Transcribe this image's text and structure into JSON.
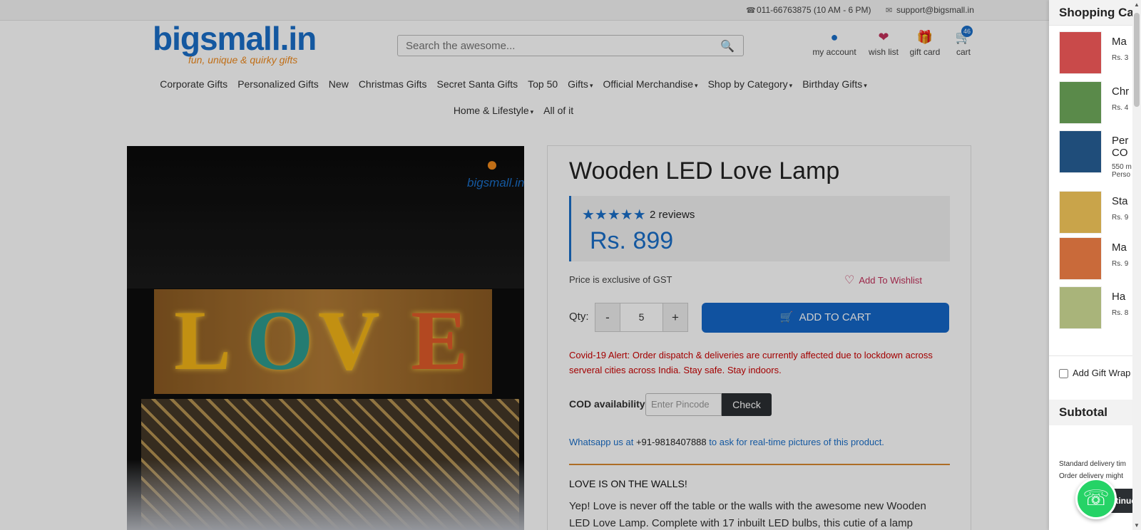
{
  "topbar": {
    "phone": "011-66763875 (10 AM - 6 PM)",
    "email": "support@bigsmall.in"
  },
  "logo": {
    "name": "bigsmall.in",
    "tagline": "fun, unique & quirky gifts"
  },
  "search": {
    "placeholder": "Search the awesome..."
  },
  "header_icons": {
    "account": "my account",
    "wishlist": "wish list",
    "giftcard": "gift card",
    "cart": "cart",
    "cart_count": "46"
  },
  "nav": {
    "row1": [
      {
        "label": "Corporate Gifts",
        "dropdown": false
      },
      {
        "label": "Personalized Gifts",
        "dropdown": false
      },
      {
        "label": "New",
        "dropdown": false
      },
      {
        "label": "Christmas Gifts",
        "dropdown": false
      },
      {
        "label": "Secret Santa Gifts",
        "dropdown": false
      },
      {
        "label": "Top 50",
        "dropdown": false
      },
      {
        "label": "Gifts",
        "dropdown": true
      },
      {
        "label": "Official Merchandise",
        "dropdown": true
      },
      {
        "label": "Shop by Category",
        "dropdown": true
      },
      {
        "label": "Birthday Gifts",
        "dropdown": true
      }
    ],
    "row2": [
      {
        "label": "Home & Lifestyle",
        "dropdown": true
      },
      {
        "label": "All of it",
        "dropdown": false
      }
    ]
  },
  "product": {
    "title": "Wooden LED Love Lamp",
    "stars": "★★★★★",
    "reviews": "2 reviews",
    "price": "Rs. 899",
    "gst_note": "Price is exclusive of GST",
    "wishlist_label": "Add To Wishlist",
    "qty_label": "Qty:",
    "qty_minus": "-",
    "qty_value": "5",
    "qty_plus": "+",
    "add_to_cart": "ADD TO CART",
    "alert": "Covid-19 Alert: Order dispatch & deliveries are currently affected due to lockdown across serveral cities across India. Stay safe. Stay indoors.",
    "cod_label": "COD availability",
    "pincode_placeholder": "Enter Pincode",
    "check_label": "Check",
    "whatsapp_prefix": "Whatsapp us at",
    "whatsapp_number": "+91-9818407888",
    "whatsapp_suffix": "to ask for real-time pictures of this product.",
    "desc_title": "LOVE IS ON THE WALLS!",
    "desc": "Yep! Love is never off the table or the walls with the awesome new Wooden LED Love Lamp. Complete with 17 inbuilt LED bulbs, this cutie of a lamp exudes",
    "image_letters": [
      "L",
      "O",
      "V",
      "E"
    ],
    "image_watermark": "bigsmall.in"
  },
  "sidecart": {
    "title": "Shopping Cart",
    "items": [
      {
        "name": "Ma",
        "price": "Rs. 3",
        "thumb_color": "#c94a4a"
      },
      {
        "name": "Chr",
        "price": "Rs. 4",
        "thumb_color": "#5a8a4a"
      },
      {
        "name": "Per",
        "name2": "CO",
        "price": "550 m",
        "price2": "Perso",
        "thumb_color": "#1f4d7a"
      },
      {
        "name": "Sta",
        "price": "Rs. 9",
        "thumb_color": "#c9a44a"
      },
      {
        "name": "Ma",
        "price": "Rs. 9",
        "thumb_color": "#c96a3a"
      },
      {
        "name": "Ha",
        "price": "Rs. 8",
        "thumb_color": "#a9b47a"
      }
    ],
    "gift_wrap": "Add Gift Wrap",
    "subtotal": "Subtotal",
    "delivery_line1": "Standard delivery tim",
    "delivery_line2": "Order delivery might",
    "continue_label": "Continue"
  },
  "colors": {
    "brand_blue": "#1a6fc9",
    "brand_orange": "#f08a1c",
    "alert_red": "#cc0000",
    "whatsapp_green": "#25d366"
  }
}
